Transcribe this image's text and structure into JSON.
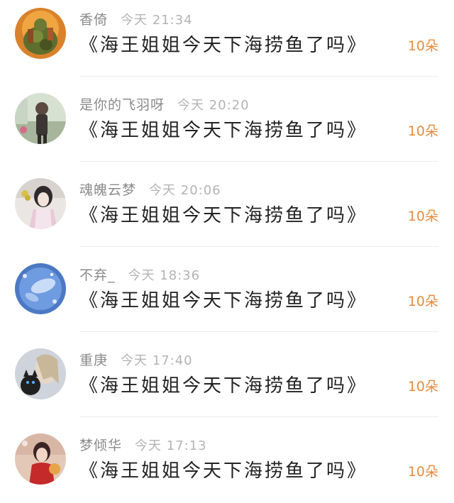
{
  "colors": {
    "nickname": "#8a8a8a",
    "time": "#b3b3b3",
    "title": "#222222",
    "count": "#e88a3c",
    "divider": "#ececec"
  },
  "items": [
    {
      "nickname": "香倚",
      "time": "今天 21:34",
      "title": "《海王姐姐今天下海捞鱼了吗》",
      "count": "10朵"
    },
    {
      "nickname": "是你的飞羽呀",
      "time": "今天 20:20",
      "title": "《海王姐姐今天下海捞鱼了吗》",
      "count": "10朵"
    },
    {
      "nickname": "魂魄云梦",
      "time": "今天 20:06",
      "title": "《海王姐姐今天下海捞鱼了吗》",
      "count": "10朵"
    },
    {
      "nickname": "不弃_",
      "time": "今天 18:36",
      "title": "《海王姐姐今天下海捞鱼了吗》",
      "count": "10朵"
    },
    {
      "nickname": "重庚",
      "time": "今天 17:40",
      "title": "《海王姐姐今天下海捞鱼了吗》",
      "count": "10朵"
    },
    {
      "nickname": "梦倾华",
      "time": "今天 17:13",
      "title": "《海王姐姐今天下海捞鱼了吗》",
      "count": "10朵"
    }
  ]
}
